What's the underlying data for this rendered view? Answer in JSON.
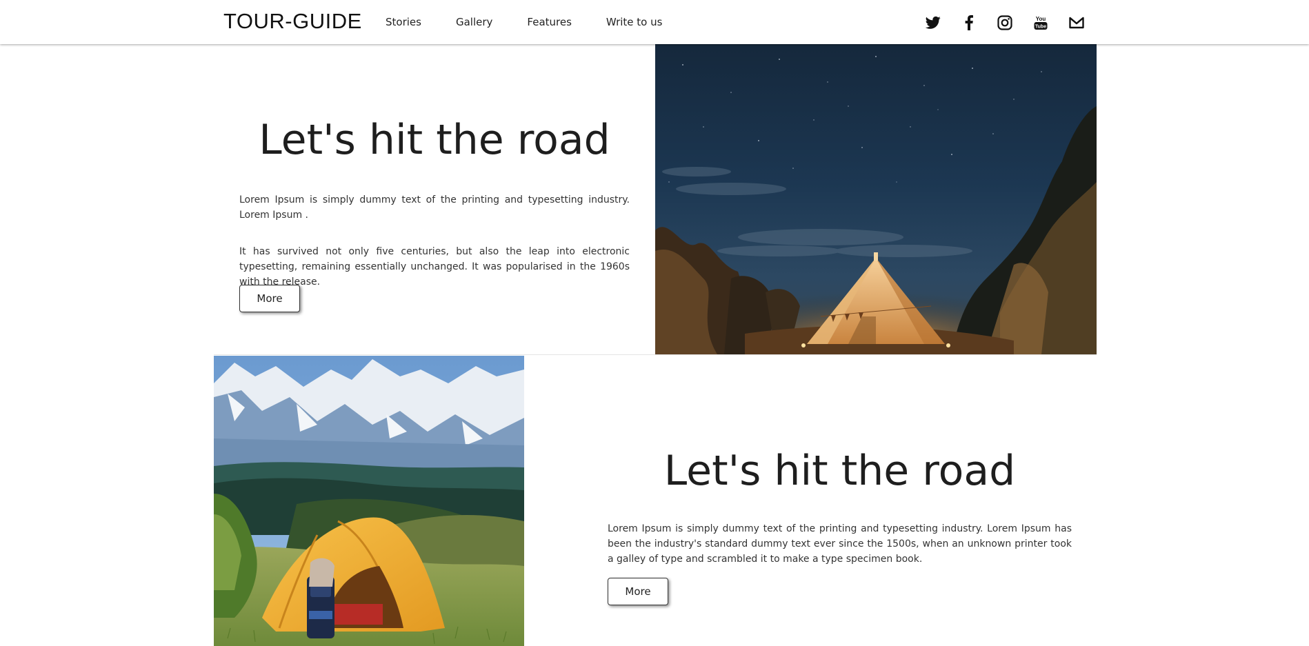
{
  "header": {
    "brand": "TOUR-GUIDE",
    "nav": [
      "Stories",
      "Gallery",
      "Features",
      "Write to us"
    ],
    "social_icons": [
      "twitter-icon",
      "facebook-icon",
      "instagram-icon",
      "youtube-icon",
      "mail-icon"
    ]
  },
  "section1": {
    "heading": "Let's hit the road",
    "paragraph1": "Lorem Ipsum is simply dummy text of the printing and typesetting industry. Lorem Ipsum .",
    "paragraph2": "It has survived not only five centuries, but also the leap into electronic typesetting, remaining essentially unchanged. It was popularised in the 1960s with the release.",
    "button": "More"
  },
  "section2": {
    "heading": "Let's hit the road",
    "paragraph1": "Lorem Ipsum is simply dummy text of the printing and typesetting industry. Lorem Ipsum has been the industry's standard dummy text ever since the 1500s, when an unknown printer took a galley of type and scrambled it to make a type specimen book.",
    "button": "More"
  },
  "colors": {
    "text": "#222222",
    "background": "#ffffff",
    "tent_orange": "#e8a43a",
    "night_sky": "#1b2b3f"
  }
}
